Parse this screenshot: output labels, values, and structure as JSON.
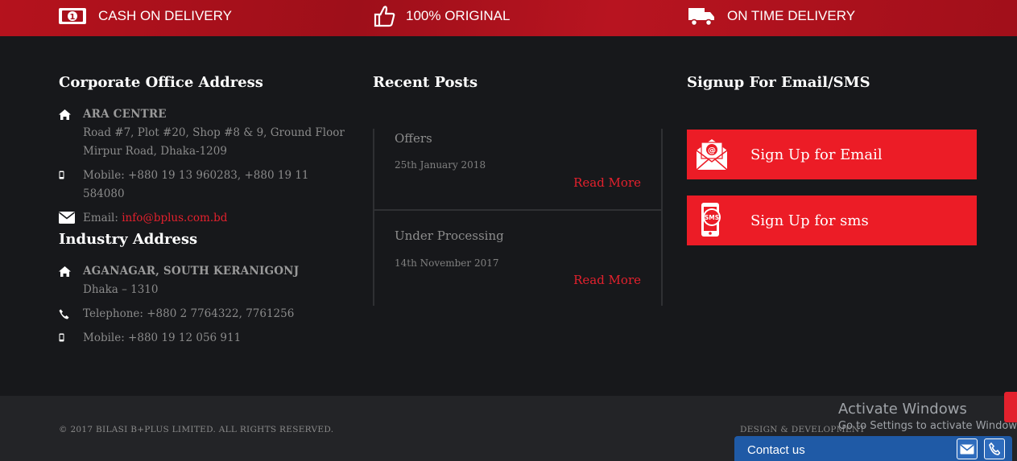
{
  "features": [
    {
      "label": "CASH ON DELIVERY",
      "icon": "cash-icon"
    },
    {
      "label": "100% ORIGINAL",
      "icon": "thumbs-up-icon"
    },
    {
      "label": "ON TIME DELIVERY",
      "icon": "truck-icon"
    }
  ],
  "corporate": {
    "title": "Corporate Office Address",
    "name": "ARA CENTRE",
    "line1": "Road #7, Plot #20, Shop #8 & 9, Ground Floor",
    "line2": "Mirpur Road, Dhaka-1209",
    "mobile": "Mobile: +880 19 13 960283, +880 19 11 584080",
    "email_label": "Email: ",
    "email": "info@bplus.com.bd"
  },
  "industry": {
    "title": "Industry Address",
    "name": "AGANAGAR, SOUTH KERANIGONJ",
    "line1": "Dhaka – 1310",
    "telephone": "Telephone: +880 2 7764322, 7761256",
    "mobile": "Mobile: +880 19 12 056 911"
  },
  "recent_posts": {
    "title": "Recent Posts",
    "items": [
      {
        "title": "Offers",
        "date": "25th January 2018",
        "more": "Read More"
      },
      {
        "title": "Under Processing",
        "date": "14th November 2017",
        "more": "Read More"
      }
    ]
  },
  "signup": {
    "title": "Signup For Email/SMS",
    "email_label": "Sign Up for Email",
    "sms_label": "Sign Up for sms",
    "sms_badge": "SMS",
    "email_badge": "@"
  },
  "footer": {
    "copyright": "© 2017 BILASI B+PLUS LIMITED. ALL RIGHTS RESERVED.",
    "design": "DESIGN & DEVELOPMENT"
  },
  "windows": {
    "line1": "Activate Windows",
    "line2": "Go to Settings to activate Windows."
  },
  "contact": {
    "label": "Contact us"
  },
  "colors": {
    "accent": "#ec1c26",
    "topbar": "#a8111c",
    "background": "#17181b",
    "footer": "#232427",
    "contact": "#1f5aa6"
  }
}
